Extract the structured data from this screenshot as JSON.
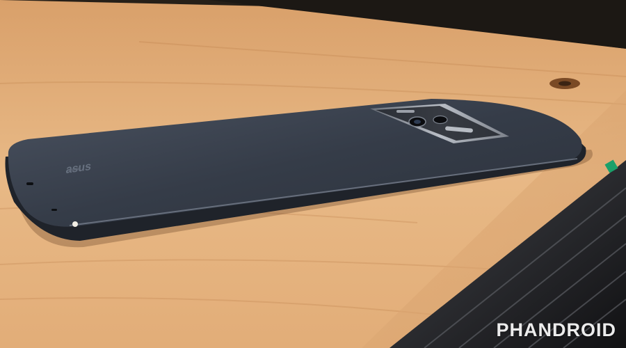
{
  "watermark": {
    "text": "PHANDROID"
  },
  "brand_mark": {
    "text": "asus"
  },
  "colors": {
    "wood": "#e4b07a",
    "wood_dark": "#c98a57",
    "phone_body": "#3a4250",
    "phone_edge": "#1c2027",
    "camera_module": "#9aa0a8",
    "background": "#1a1612",
    "cable": "#1b1b1d"
  },
  "icons": [
    "camera-lens-icon",
    "flash-icon",
    "brand-logo-icon"
  ]
}
